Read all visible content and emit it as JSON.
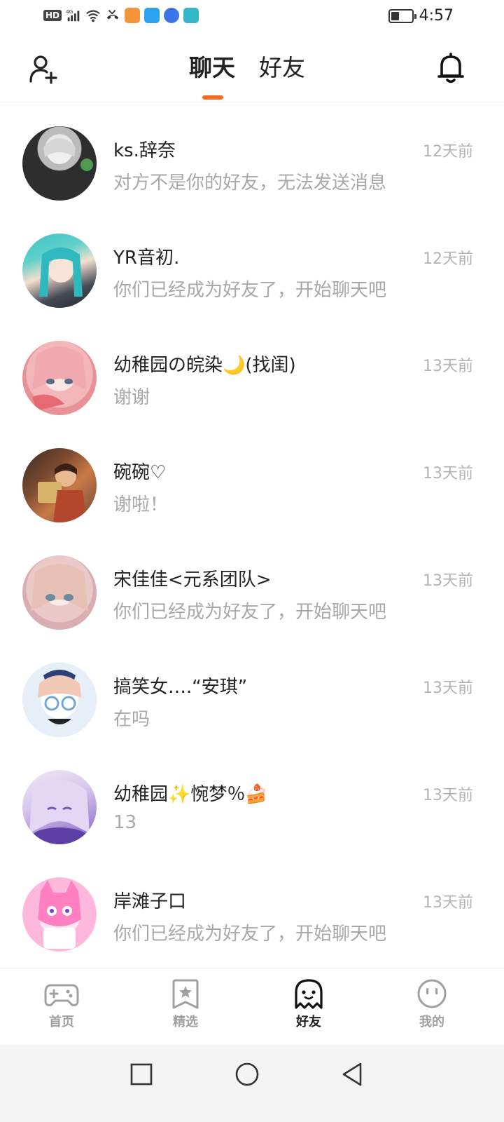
{
  "status_bar": {
    "hd": "HD",
    "network": "4G",
    "time": "4:57",
    "battery_level": 0.4
  },
  "header": {
    "tabs": [
      {
        "label": "聊天",
        "active": true
      },
      {
        "label": "好友",
        "active": false
      }
    ],
    "accent_color": "#f26b22"
  },
  "chats": [
    {
      "name": "ks.辞奈",
      "preview": "对方不是你的好友，无法发送消息",
      "time": "12天前"
    },
    {
      "name": "YR音初.",
      "preview": "你们已经成为好友了，开始聊天吧",
      "time": "12天前"
    },
    {
      "name": "幼稚园の皖染🌙(找闺)",
      "preview": "谢谢",
      "time": "13天前"
    },
    {
      "name": "碗碗♡",
      "preview": "谢啦！",
      "time": "13天前"
    },
    {
      "name": "宋佳佳<元系团队>",
      "preview": "你们已经成为好友了，开始聊天吧",
      "time": "13天前"
    },
    {
      "name": "搞笑女….“安琪”",
      "preview": "在吗",
      "time": "13天前"
    },
    {
      "name": "幼稚园✨惋梦％🍰",
      "preview": "13",
      "time": "13天前"
    },
    {
      "name": "岸滩子口",
      "preview": "你们已经成为好友了，开始聊天吧",
      "time": "13天前"
    }
  ],
  "bottom_nav": [
    {
      "label": "首页",
      "icon": "gamepad-icon",
      "active": false
    },
    {
      "label": "精选",
      "icon": "star-bookmark-icon",
      "active": false
    },
    {
      "label": "好友",
      "icon": "ghost-icon",
      "active": true
    },
    {
      "label": "我的",
      "icon": "face-icon",
      "active": false
    }
  ]
}
